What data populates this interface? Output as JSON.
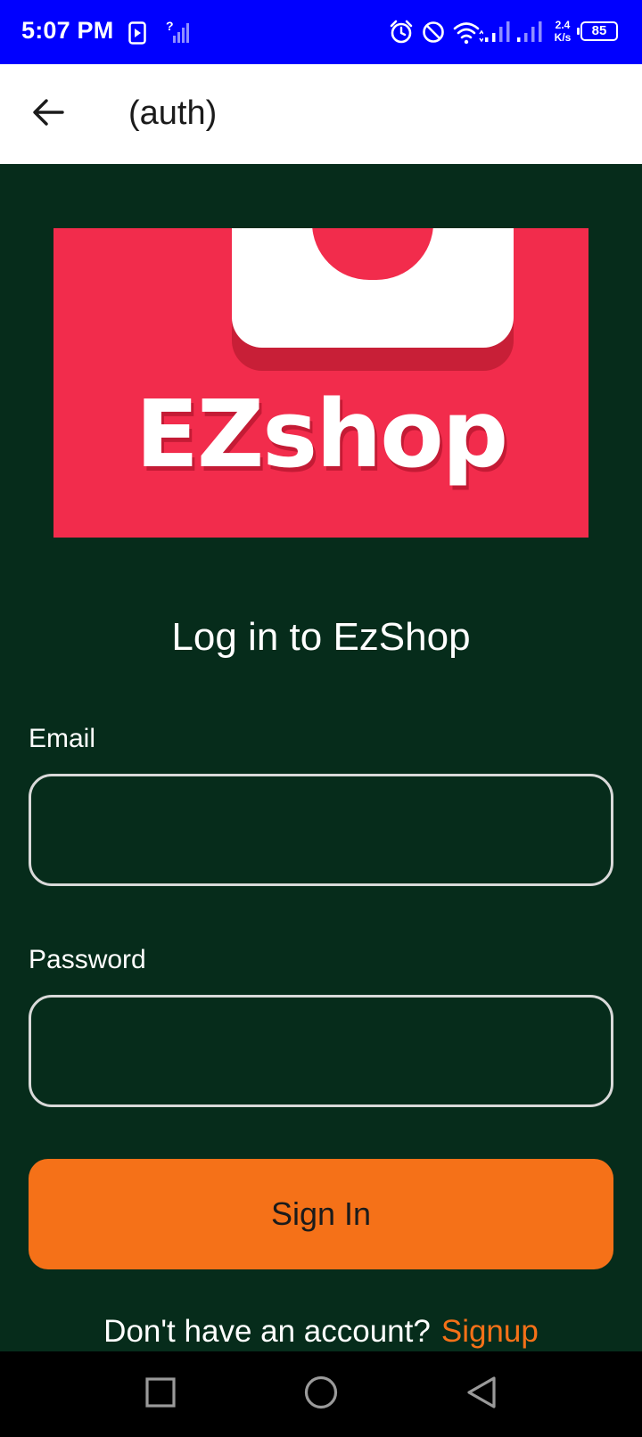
{
  "status_bar": {
    "time": "5:07 PM",
    "network_speed_value": "2.4",
    "network_speed_unit": "K/s",
    "battery": "85",
    "icons": [
      "media-play-icon",
      "no-sim-signal-icon",
      "alarm-icon",
      "do-not-disturb-icon",
      "wifi-icon",
      "cell-signal-icon",
      "cell-signal-2-icon"
    ]
  },
  "app_bar": {
    "title": "(auth)",
    "back_icon": "arrow-left-icon"
  },
  "logo": {
    "brand": "EZshop",
    "colors": {
      "background": "#f22c4c",
      "bag": "#ffffff"
    }
  },
  "login": {
    "heading": "Log in to EzShop",
    "email_label": "Email",
    "email_value": "",
    "password_label": "Password",
    "password_value": "",
    "signin_label": "Sign In",
    "no_account_text": "Don't have an account?",
    "signup_link": "Signup"
  },
  "nav_bar": {
    "icons": [
      "recent-apps-icon",
      "home-icon",
      "back-triangle-icon"
    ]
  },
  "colors": {
    "status_bar": "#0000ff",
    "page_background": "#062c1b",
    "accent": "#f57118",
    "field_border": "#d9d9d9"
  }
}
